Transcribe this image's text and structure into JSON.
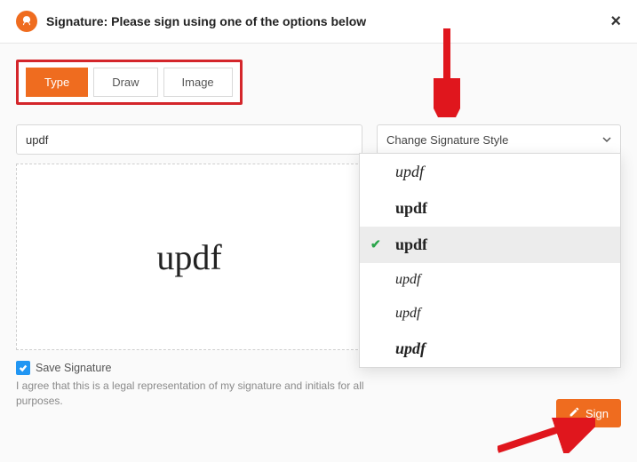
{
  "header": {
    "title": "Signature: Please sign using one of the options below"
  },
  "tabs": {
    "type": "Type",
    "draw": "Draw",
    "image": "Image"
  },
  "signature": {
    "input_value": "updf",
    "preview_text": "updf"
  },
  "style_select": {
    "label": "Change Signature Style"
  },
  "style_options": [
    {
      "text": "updf"
    },
    {
      "text": "updf"
    },
    {
      "text": "updf"
    },
    {
      "text": "updf"
    },
    {
      "text": "updf"
    },
    {
      "text": "updf"
    }
  ],
  "save": {
    "label": "Save Signature",
    "checked": true
  },
  "disclaimer": "I agree that this is a legal representation of my signature and initials for all purposes.",
  "actions": {
    "sign": "Sign"
  }
}
